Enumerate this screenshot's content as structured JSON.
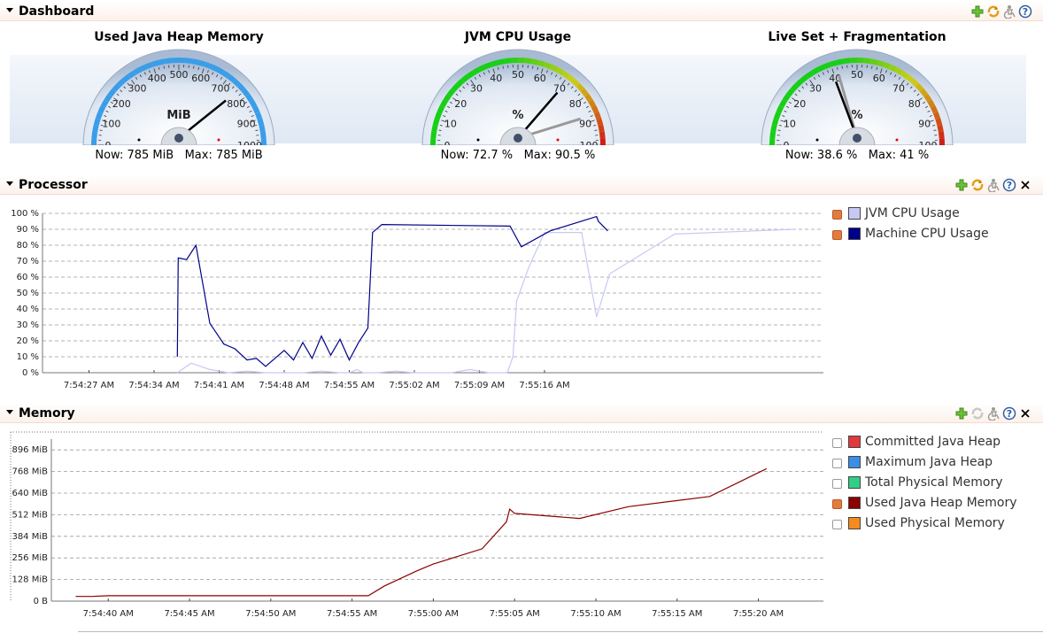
{
  "dashboard": {
    "title": "Dashboard",
    "gauges": [
      {
        "title": "Used Java Heap Memory",
        "unit": "MiB",
        "ticks": [
          "0",
          "100",
          "200",
          "300",
          "400",
          "500",
          "600",
          "700",
          "800",
          "900",
          "1000"
        ],
        "min": 0,
        "max": 1000,
        "value": 785,
        "max_marker": 785,
        "scheme": "blue",
        "now_text": "Now: 785 MiB",
        "max_text": "Max: 785 MiB"
      },
      {
        "title": "JVM CPU Usage",
        "unit": "%",
        "ticks": [
          "0",
          "10",
          "20",
          "30",
          "40",
          "50",
          "60",
          "70",
          "80",
          "90",
          "100"
        ],
        "min": 0,
        "max": 100,
        "value": 72.7,
        "max_marker": 90.5,
        "scheme": "gyr",
        "now_text": "Now: 72.7 %",
        "max_text": "Max: 90.5 %"
      },
      {
        "title": "Live Set + Fragmentation",
        "unit": "%",
        "ticks": [
          "0",
          "10",
          "20",
          "30",
          "40",
          "50",
          "60",
          "70",
          "80",
          "90",
          "100"
        ],
        "min": 0,
        "max": 100,
        "value": 38.6,
        "max_marker": 41,
        "scheme": "gyr",
        "now_text": "Now: 38.6 %",
        "max_text": "Max: 41 %"
      }
    ]
  },
  "processor": {
    "title": "Processor",
    "legend": [
      {
        "label": "JVM CPU Usage",
        "color": "#c8c8f5",
        "checked": true
      },
      {
        "label": "Machine CPU Usage",
        "color": "#00008b",
        "checked": true
      }
    ]
  },
  "memory": {
    "title": "Memory",
    "legend": [
      {
        "label": "Committed Java Heap",
        "color": "#e0393e",
        "checked": false
      },
      {
        "label": "Maximum Java Heap",
        "color": "#3a8ee6",
        "checked": false
      },
      {
        "label": "Total Physical Memory",
        "color": "#2fcf86",
        "checked": false
      },
      {
        "label": "Used Java Heap Memory",
        "color": "#8b0000",
        "checked": true
      },
      {
        "label": "Used Physical Memory",
        "color": "#f58a1f",
        "checked": false
      }
    ]
  },
  "toolbar": {
    "icons": [
      "add-icon",
      "refresh-icon",
      "accessibility-icon",
      "help-icon",
      "close-icon"
    ]
  },
  "chart_data": [
    {
      "type": "line",
      "title": "Processor",
      "xlabel": "",
      "ylabel": "",
      "ylim": [
        0,
        100
      ],
      "yticks": [
        "0 %",
        "10 %",
        "20 %",
        "30 %",
        "40 %",
        "50 %",
        "60 %",
        "70 %",
        "80 %",
        "90 %",
        "100 %"
      ],
      "xticks": [
        "7:54:27 AM",
        "7:54:34 AM",
        "7:54:41 AM",
        "7:54:48 AM",
        "7:54:55 AM",
        "7:55:02 AM",
        "7:55:09 AM",
        "7:55:16 AM"
      ],
      "xlim_seconds": [
        22,
        85
      ],
      "grid": true,
      "legend_position": "right",
      "series": [
        {
          "name": "JVM CPU Usage",
          "color": "#c8c8f5",
          "x": [
            36.5,
            38,
            40,
            42,
            44,
            46,
            48,
            50,
            52,
            54,
            55,
            55.8,
            56.5,
            58,
            60,
            62,
            64,
            66,
            68,
            70,
            72,
            72.6,
            73,
            74.3,
            80,
            86,
            90,
            95,
            100,
            106
          ],
          "y": [
            0,
            6,
            2,
            0,
            1,
            0,
            0,
            0,
            1,
            0,
            0,
            2,
            0,
            0,
            1,
            0,
            0,
            0,
            2,
            0,
            0,
            10,
            45,
            66,
            88,
            88,
            35,
            62,
            87,
            90
          ],
          "x_sec": [
            36.5,
            38,
            40,
            42,
            44,
            46,
            48,
            50,
            52,
            54,
            55,
            55.8,
            56.5,
            58,
            60,
            62,
            64,
            66,
            68,
            70,
            72,
            72.6,
            73,
            74.3,
            76,
            80,
            81.6,
            83,
            90,
            103,
            106
          ]
        },
        {
          "name": "Machine CPU Usage",
          "color": "#00008b",
          "x_sec": [
            36.5,
            36.6,
            37.5,
            38.5,
            40,
            41.5,
            42.7,
            44,
            45,
            46,
            47,
            48,
            49,
            50,
            51,
            52,
            53,
            54,
            55,
            56,
            57,
            57.5,
            58.5,
            72.3,
            73.5,
            76.6,
            81.6,
            81.8,
            82.8,
            88,
            96,
            102.5,
            106
          ],
          "y": [
            10,
            72,
            71,
            80,
            31,
            18,
            15,
            8,
            9,
            4,
            9,
            14,
            8,
            19,
            9,
            23,
            11,
            21,
            8,
            19,
            28,
            88,
            93,
            92,
            79,
            89,
            98,
            95,
            89
          ]
        }
      ]
    },
    {
      "type": "line",
      "title": "Memory",
      "xlabel": "",
      "ylabel": "",
      "ylim": [
        0,
        960
      ],
      "yticks": [
        "0 B",
        "128 MiB",
        "256 MiB",
        "384 MiB",
        "512 MiB",
        "640 MiB",
        "768 MiB",
        "896 MiB"
      ],
      "xticks": [
        "7:54:40 AM",
        "7:54:45 AM",
        "7:54:50 AM",
        "7:54:55 AM",
        "7:55:00 AM",
        "7:55:05 AM",
        "7:55:10 AM",
        "7:55:15 AM",
        "7:55:20 AM"
      ],
      "grid": true,
      "legend_position": "right",
      "series": [
        {
          "name": "Used Java Heap Memory",
          "color": "#8b0000",
          "x_sec": [
            38,
            39,
            40,
            44,
            50,
            56,
            57,
            59,
            60,
            63,
            64.5,
            64.7,
            65,
            69,
            72,
            77,
            80.5
          ],
          "y": [
            28,
            28,
            32,
            32,
            32,
            32,
            90,
            180,
            220,
            310,
            470,
            545,
            520,
            490,
            560,
            620,
            785
          ]
        }
      ]
    }
  ]
}
